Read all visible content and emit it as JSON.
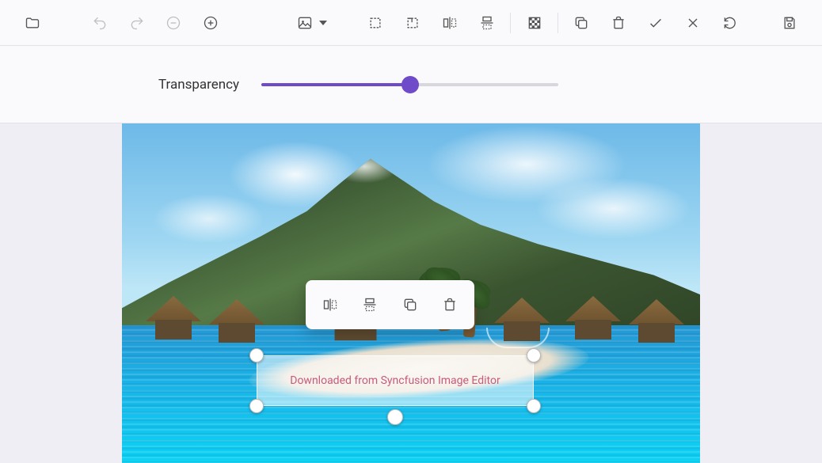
{
  "transparency": {
    "label": "Transparency",
    "percent": 50
  },
  "selection": {
    "text": "Downloaded from Syncfusion Image Editor"
  },
  "toolbar": {
    "open": "Open",
    "undo": "Undo",
    "redo": "Redo",
    "zoom_out": "Zoom out",
    "zoom_in": "Zoom in",
    "image": "Image",
    "crop": "Crop",
    "resize": "Resize",
    "flip_h": "Flip horizontal",
    "flip_v": "Flip vertical",
    "transparency": "Transparency",
    "duplicate": "Duplicate",
    "delete": "Delete",
    "confirm": "Confirm",
    "cancel": "Cancel",
    "reset": "Reset",
    "save": "Save"
  },
  "float_toolbar": {
    "flip_h": "Flip horizontal",
    "flip_v": "Flip vertical",
    "duplicate": "Duplicate",
    "delete": "Delete"
  }
}
